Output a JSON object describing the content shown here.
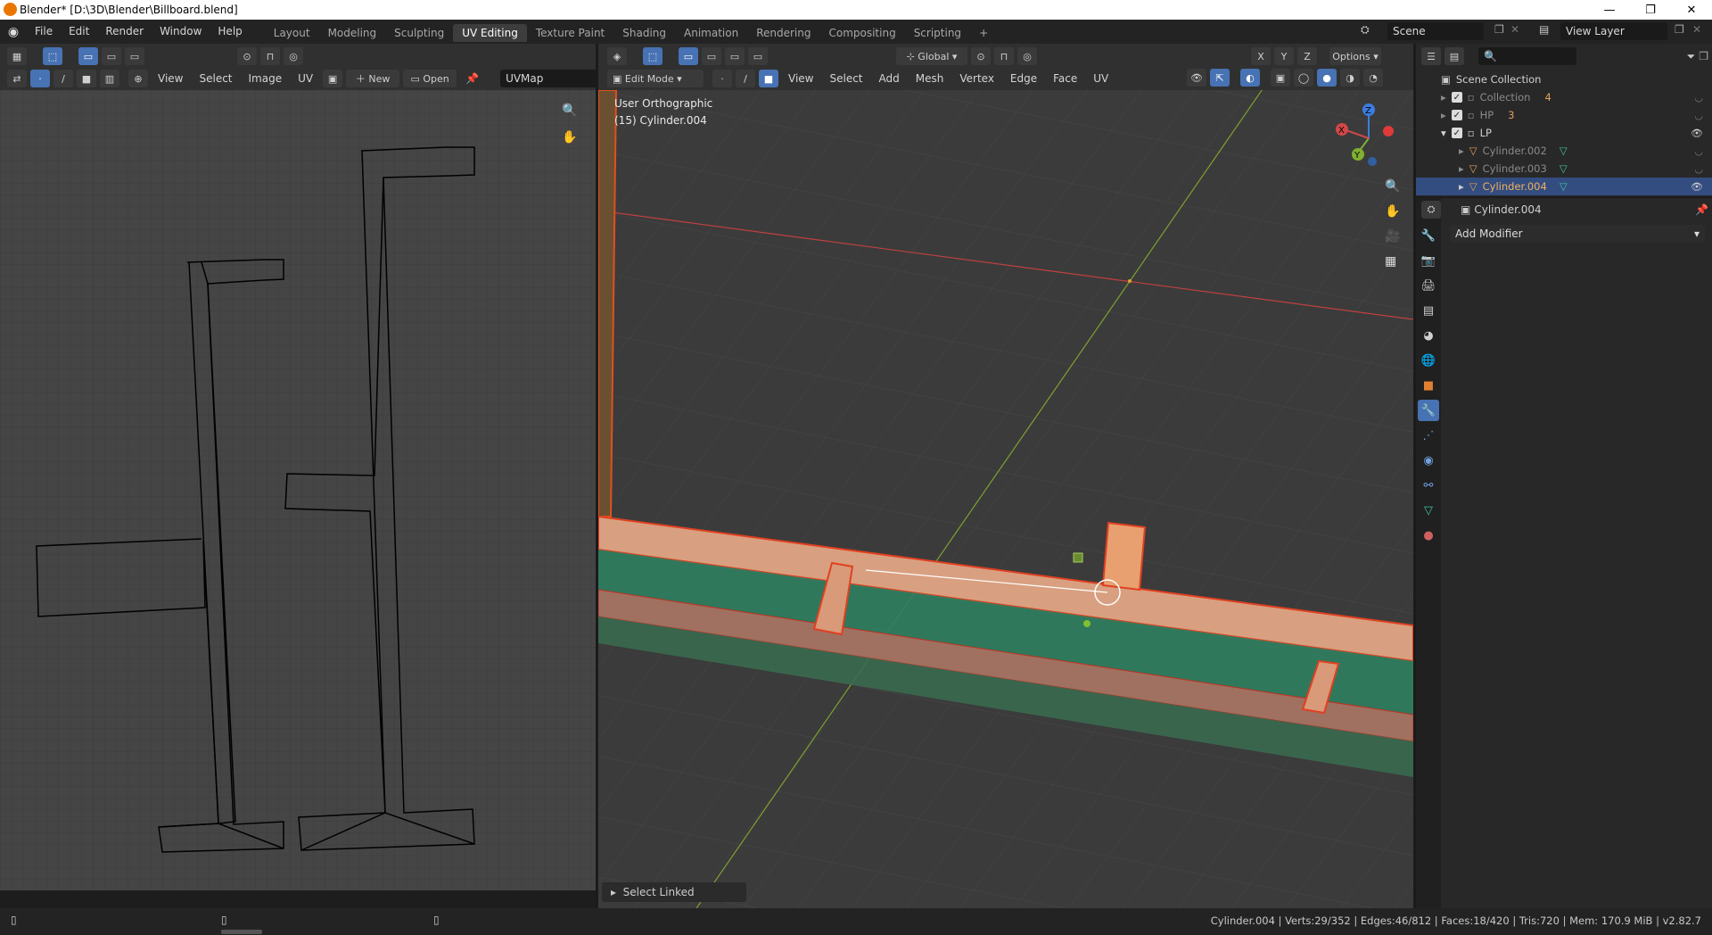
{
  "window": {
    "title": "Blender* [D:\\3D\\Blender\\Billboard.blend]",
    "minimize": "—",
    "maximize": "❐",
    "close": "✕"
  },
  "menu": [
    "File",
    "Edit",
    "Render",
    "Window",
    "Help"
  ],
  "workspaces": {
    "tabs": [
      "Layout",
      "Modeling",
      "Sculpting",
      "UV Editing",
      "Texture Paint",
      "Shading",
      "Animation",
      "Rendering",
      "Compositing",
      "Scripting"
    ],
    "active": "UV Editing",
    "add": "+"
  },
  "scene": {
    "name": "Scene",
    "view_layer": "View Layer"
  },
  "uv_editor": {
    "menus": [
      "View",
      "Select",
      "Image",
      "UV"
    ],
    "new_label": "New",
    "open_label": "Open",
    "uvmap": "UVMap"
  },
  "viewport": {
    "mode": "Edit Mode",
    "menus": [
      "View",
      "Select",
      "Add",
      "Mesh",
      "Vertex",
      "Edge",
      "Face",
      "UV"
    ],
    "orientation": "Global",
    "options_label": "Options",
    "axes": [
      "X",
      "Y",
      "Z"
    ],
    "info_line1": "User Orthographic",
    "info_line2": "(15) Cylinder.004",
    "gizmo_labels": [
      "Z",
      "Y",
      "X"
    ],
    "operator_panel": "Select Linked"
  },
  "outliner": {
    "root": "Scene Collection",
    "items": [
      {
        "label": "Collection",
        "badge": "4"
      },
      {
        "label": "HP",
        "badge": "3"
      },
      {
        "label": "LP",
        "badge": ""
      },
      {
        "label": "Cylinder.002",
        "badge": ""
      },
      {
        "label": "Cylinder.003",
        "badge": ""
      },
      {
        "label": "Cylinder.004",
        "badge": ""
      }
    ],
    "selected": "Cylinder.004"
  },
  "properties": {
    "object_name": "Cylinder.004",
    "add_modifier": "Add Modifier"
  },
  "status": {
    "text": "Cylinder.004 | Verts:29/352 | Edges:46/812 | Faces:18/420 | Tris:720 | Mem: 170.9 MiB | v2.82.7"
  },
  "colors": {
    "accent_blue": "#4772b3",
    "selection_orange": "#e8a070",
    "axis_red": "#c04040",
    "axis_green": "#7fa030"
  }
}
